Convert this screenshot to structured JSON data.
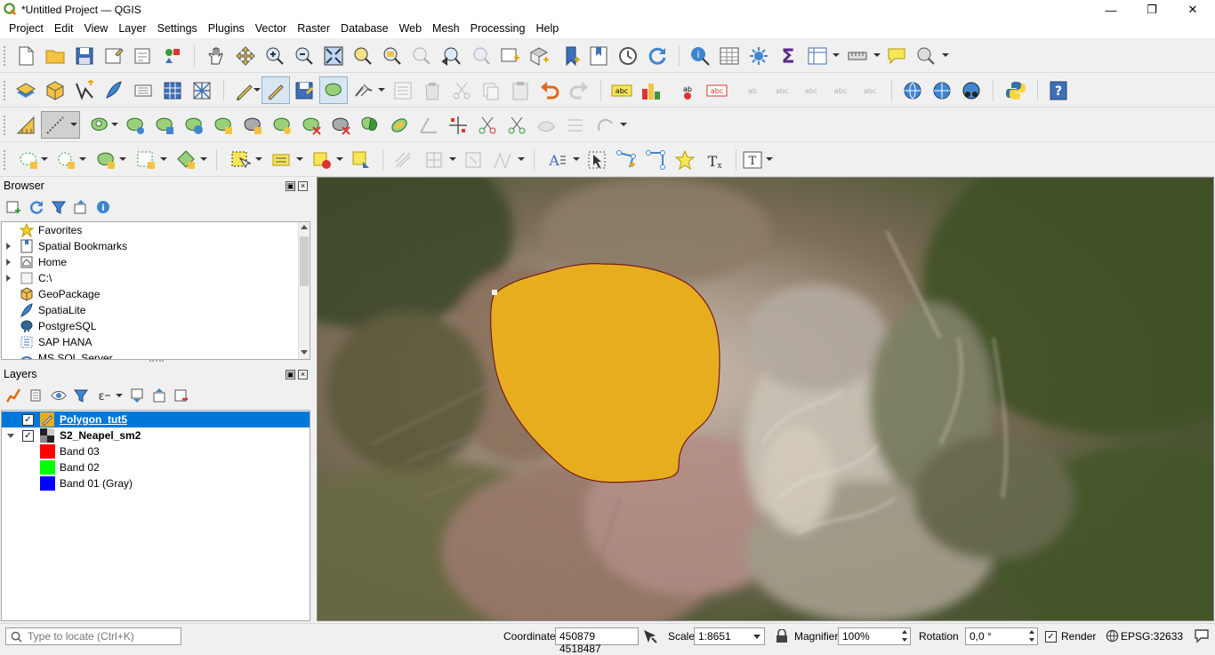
{
  "window": {
    "title": "*Untitled Project — QGIS",
    "minimize": "—",
    "maximize": "❐",
    "close": "✕"
  },
  "menubar": [
    "Project",
    "Edit",
    "View",
    "Layer",
    "Settings",
    "Plugins",
    "Vector",
    "Raster",
    "Database",
    "Web",
    "Mesh",
    "Processing",
    "Help"
  ],
  "toolbar_icons": {
    "row1": [
      "new-project-icon",
      "open-project-icon",
      "save-project-icon",
      "new-print-layout-icon",
      "layout-manager-icon",
      "style-manager-icon",
      "pan-icon",
      "pan-to-selection-icon",
      "zoom-in-icon",
      "zoom-out-icon",
      "zoom-full-icon",
      "zoom-to-selection-icon",
      "zoom-to-layer-icon",
      "zoom-native-icon",
      "zoom-last-icon",
      "zoom-next-icon",
      "new-map-view-icon",
      "new-3d-map-view-icon",
      "new-spatial-bookmark-icon",
      "show-spatial-bookmarks-icon",
      "temporal-controller-icon",
      "refresh-icon",
      "identify-features-icon",
      "attribute-table-icon",
      "toolbox-icon",
      "statistical-summary-icon",
      "open-field-calculator-icon",
      "measure-icon",
      "map-tips-icon",
      "locator-settings-icon"
    ],
    "row2": [
      "data-source-manager-icon",
      "new-geopackage-layer-icon",
      "new-shapefile-layer-icon",
      "new-spatialite-layer-icon",
      "new-virtual-layer-icon",
      "add-raster-icon",
      "add-mesh-icon",
      "current-edits-icon",
      "toggle-editing-icon",
      "save-layer-edits-icon",
      "add-polygon-icon",
      "vertex-tool-icon",
      "modify-attributes-icon",
      "delete-selected-icon",
      "cut-features-icon",
      "copy-features-icon",
      "paste-features-icon",
      "undo-icon",
      "redo-icon",
      "label-toolbar-icon",
      "diagram-icon",
      "highlight-pinned-label-icon",
      "pin-label-icon",
      "show-hide-labels-icon",
      "move-label-icon",
      "rotate-label-icon",
      "change-label-icon",
      "metasearch-icon",
      "wms-icon",
      "quickmapservices-icon",
      "python-console-icon",
      "help-icon"
    ],
    "row3": [
      "digitize-with-segment-icon",
      "digitizing-tools-icon",
      "add-ring-icon",
      "add-part-icon",
      "fill-ring-icon",
      "delete-ring-icon",
      "delete-part-icon",
      "reshape-features-icon",
      "offset-curve-icon",
      "split-features-icon",
      "split-parts-icon",
      "merge-features-icon",
      "merge-attributes-icon",
      "rotate-point-symbols-icon",
      "offset-point-symbols-icon",
      "reverse-line-icon",
      "trim-extend-icon"
    ],
    "row4": [
      "select-by-rectangle-icon",
      "select-by-value-icon",
      "deselect-all-icon",
      "select-all-icon",
      "text-annotation-icon",
      "html-annotation-icon",
      "svg-annotation-icon",
      "form-annotation-icon",
      "move-annotation-icon",
      "add-vertex-icon",
      "star-icon",
      "text-icon"
    ]
  },
  "browser_panel": {
    "title": "Browser",
    "items": [
      {
        "label": "Favorites",
        "icon": "star-icon",
        "expandable": false
      },
      {
        "label": "Spatial Bookmarks",
        "icon": "bookmark-icon",
        "expandable": true
      },
      {
        "label": "Home",
        "icon": "home-icon",
        "expandable": true
      },
      {
        "label": "C:\\",
        "icon": "drive-icon",
        "expandable": true
      },
      {
        "label": "GeoPackage",
        "icon": "geopackage-icon",
        "expandable": false
      },
      {
        "label": "SpatiaLite",
        "icon": "spatialite-icon",
        "expandable": false
      },
      {
        "label": "PostgreSQL",
        "icon": "postgresql-icon",
        "expandable": false
      },
      {
        "label": "SAP HANA",
        "icon": "sap-hana-icon",
        "expandable": false
      },
      {
        "label": "MS SQL Server",
        "icon": "mssql-icon",
        "expandable": false
      }
    ]
  },
  "layers_panel": {
    "title": "Layers",
    "layers": [
      {
        "label": "Polygon_tut5",
        "checked": "✓",
        "selected": true,
        "type": "vector"
      },
      {
        "label": "S2_Neapel_sm2",
        "checked": "✓",
        "selected": false,
        "type": "raster"
      }
    ],
    "bands": [
      {
        "label": "Band 03",
        "color": "#ff0000"
      },
      {
        "label": "Band 02",
        "color": "#00ff00"
      },
      {
        "label": "Band 01 (Gray)",
        "color": "#0000ff"
      }
    ]
  },
  "map": {
    "polygon_fill": "#e6ae1f",
    "polygon_stroke": "#7a1a1a"
  },
  "statusbar": {
    "locator_placeholder": "Type to locate (Ctrl+K)",
    "coordinate_label": "Coordinate",
    "coordinate_value": "450879 4518487",
    "scale_label": "Scale",
    "scale_value": "1:8651",
    "magnifier_label": "Magnifier",
    "magnifier_value": "100%",
    "rotation_label": "Rotation",
    "rotation_value": "0,0 °",
    "render_label": "Render",
    "render_checked": "✓",
    "crs_label": "EPSG:32633"
  }
}
